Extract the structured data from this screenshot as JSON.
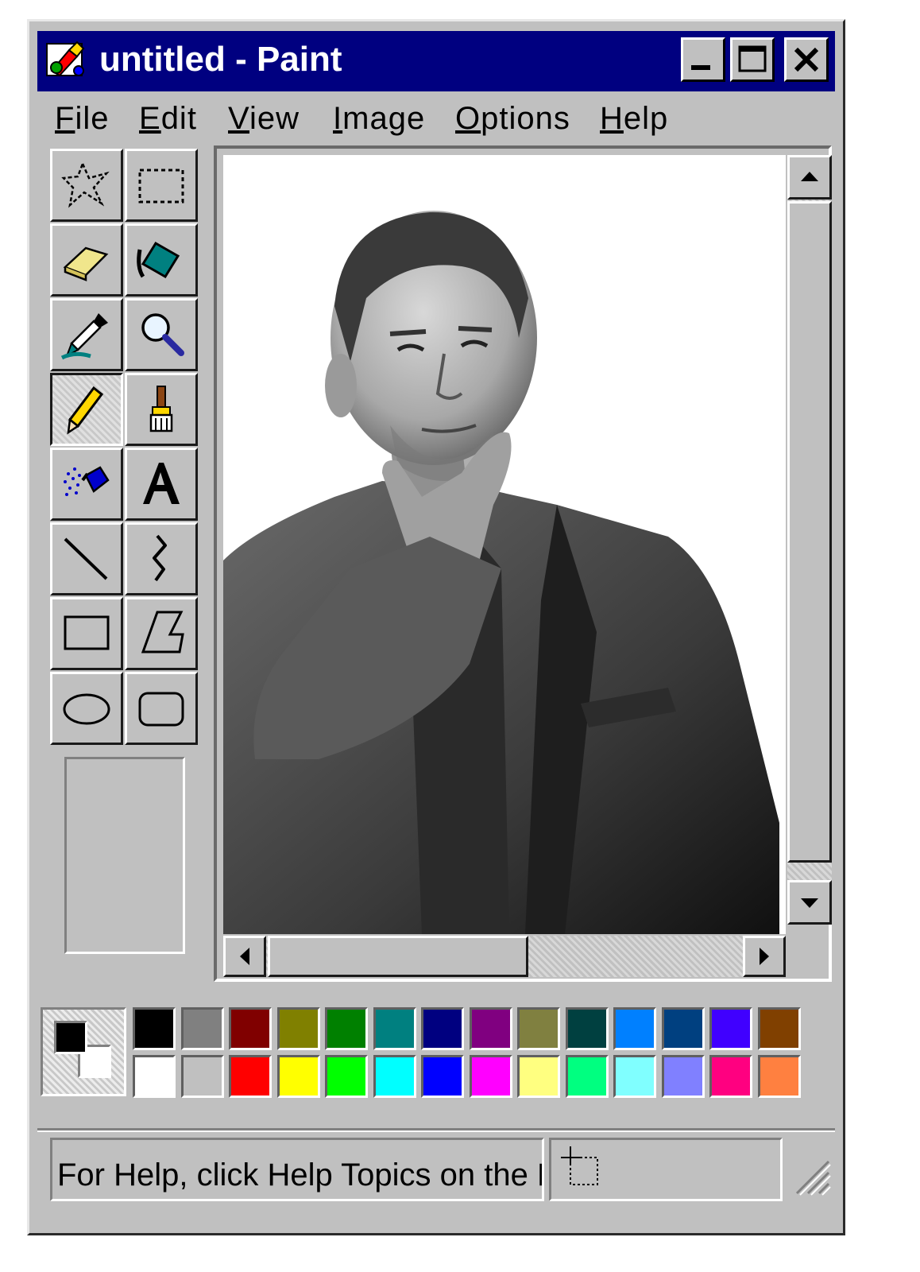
{
  "window": {
    "title": "untitled - Paint",
    "title_bar_color": "#000080",
    "buttons": [
      "minimize-icon",
      "maximize-icon",
      "close-icon"
    ]
  },
  "menu": {
    "items": [
      {
        "label": "File",
        "mnemonic": "F"
      },
      {
        "label": "Edit",
        "mnemonic": "E"
      },
      {
        "label": "View",
        "mnemonic": "V"
      },
      {
        "label": "Image",
        "mnemonic": "I"
      },
      {
        "label": "Options",
        "mnemonic": "O"
      },
      {
        "label": "Help",
        "mnemonic": "H"
      }
    ]
  },
  "tools": [
    {
      "name": "free-form-select-icon"
    },
    {
      "name": "select-icon"
    },
    {
      "name": "eraser-icon"
    },
    {
      "name": "fill-bucket-icon"
    },
    {
      "name": "color-picker-icon"
    },
    {
      "name": "magnifier-icon"
    },
    {
      "name": "pencil-icon",
      "active": true
    },
    {
      "name": "brush-icon"
    },
    {
      "name": "airbrush-icon"
    },
    {
      "name": "text-icon",
      "glyph": "A"
    },
    {
      "name": "line-icon"
    },
    {
      "name": "curve-icon"
    },
    {
      "name": "rectangle-icon"
    },
    {
      "name": "polygon-icon"
    },
    {
      "name": "ellipse-icon"
    },
    {
      "name": "rounded-rectangle-icon"
    }
  ],
  "canvas": {
    "content": "portrait-photo"
  },
  "palette": {
    "foreground": "#000000",
    "background": "#ffffff",
    "row1": [
      "#000000",
      "#808080",
      "#800000",
      "#808000",
      "#008000",
      "#008080",
      "#000080",
      "#800080",
      "#808040",
      "#004040",
      "#0080ff",
      "#004080",
      "#4000ff",
      "#804000"
    ],
    "row2": [
      "#ffffff",
      "#c0c0c0",
      "#ff0000",
      "#ffff00",
      "#00ff00",
      "#00ffff",
      "#0000ff",
      "#ff00ff",
      "#ffff80",
      "#00ff80",
      "#80ffff",
      "#8080ff",
      "#ff0080",
      "#ff8040"
    ]
  },
  "status": {
    "help_text": "For Help, click Help Topics on the Help Menu."
  }
}
